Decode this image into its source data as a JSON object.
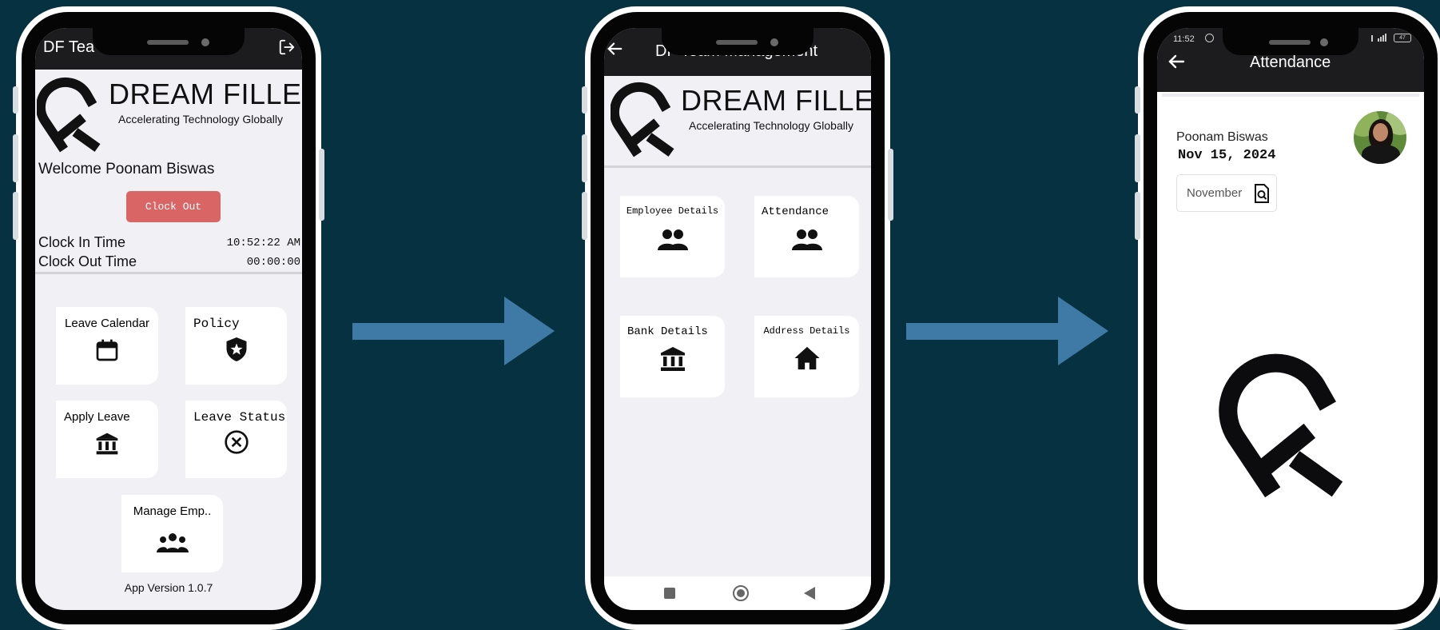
{
  "phone1": {
    "appbar_title": "DF Tea",
    "brand": "DREAM FILLER",
    "tagline": "Accelerating Technology Globally",
    "welcome": "Welcome Poonam Biswas",
    "clock_button": "Clock Out",
    "clock_in_label": "Clock In Time",
    "clock_in_value": "10:52:22 AM",
    "clock_out_label": "Clock Out Time",
    "clock_out_value": "00:00:00",
    "cards": [
      {
        "label": "Leave Calendar",
        "icon": "calendar-icon"
      },
      {
        "label": "Policy",
        "icon": "shield-star-icon"
      },
      {
        "label": "Apply Leave",
        "icon": "bank-icon"
      },
      {
        "label": "Leave Status",
        "icon": "cancel-circle-icon"
      },
      {
        "label": "Manage Emp..",
        "icon": "group-icon"
      }
    ],
    "version": "App Version 1.0.7",
    "accent_color": "#d96565"
  },
  "phone2": {
    "appbar_title": "DF Team Management",
    "brand": "DREAM FILLER",
    "tagline": "Accelerating Technology Globally",
    "cards": [
      {
        "label": "Employee Details",
        "icon": "people-icon"
      },
      {
        "label": "Attendance",
        "icon": "people-icon"
      },
      {
        "label": "Bank Details",
        "icon": "bank-icon"
      },
      {
        "label": "Address Details",
        "icon": "home-icon"
      }
    ]
  },
  "phone3": {
    "status_time": "11:52",
    "status_battery": "47",
    "appbar_title": "Attendance",
    "name": "Poonam Biswas",
    "date": "Nov 15, 2024",
    "month_chip": "November"
  },
  "colors": {
    "background": "#063140",
    "arrow": "#3f7aa6",
    "appbar": "#1c1c1e"
  }
}
